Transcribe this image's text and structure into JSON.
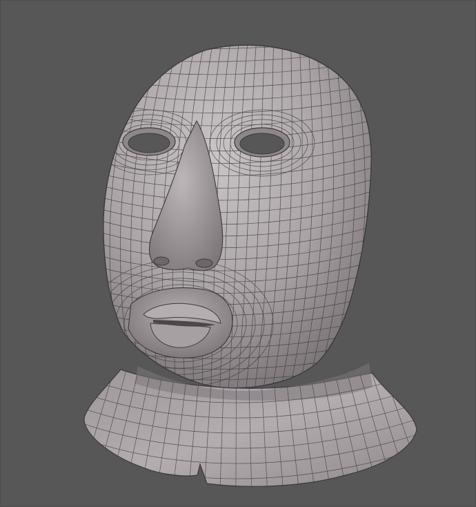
{
  "viewport": {
    "background_color": "#575757"
  },
  "model": {
    "surface_color": "#a9a3a6",
    "shadow_color": "#6f696c",
    "highlight_color": "#c9c4c6",
    "wire_color": "#3d3a3c"
  }
}
